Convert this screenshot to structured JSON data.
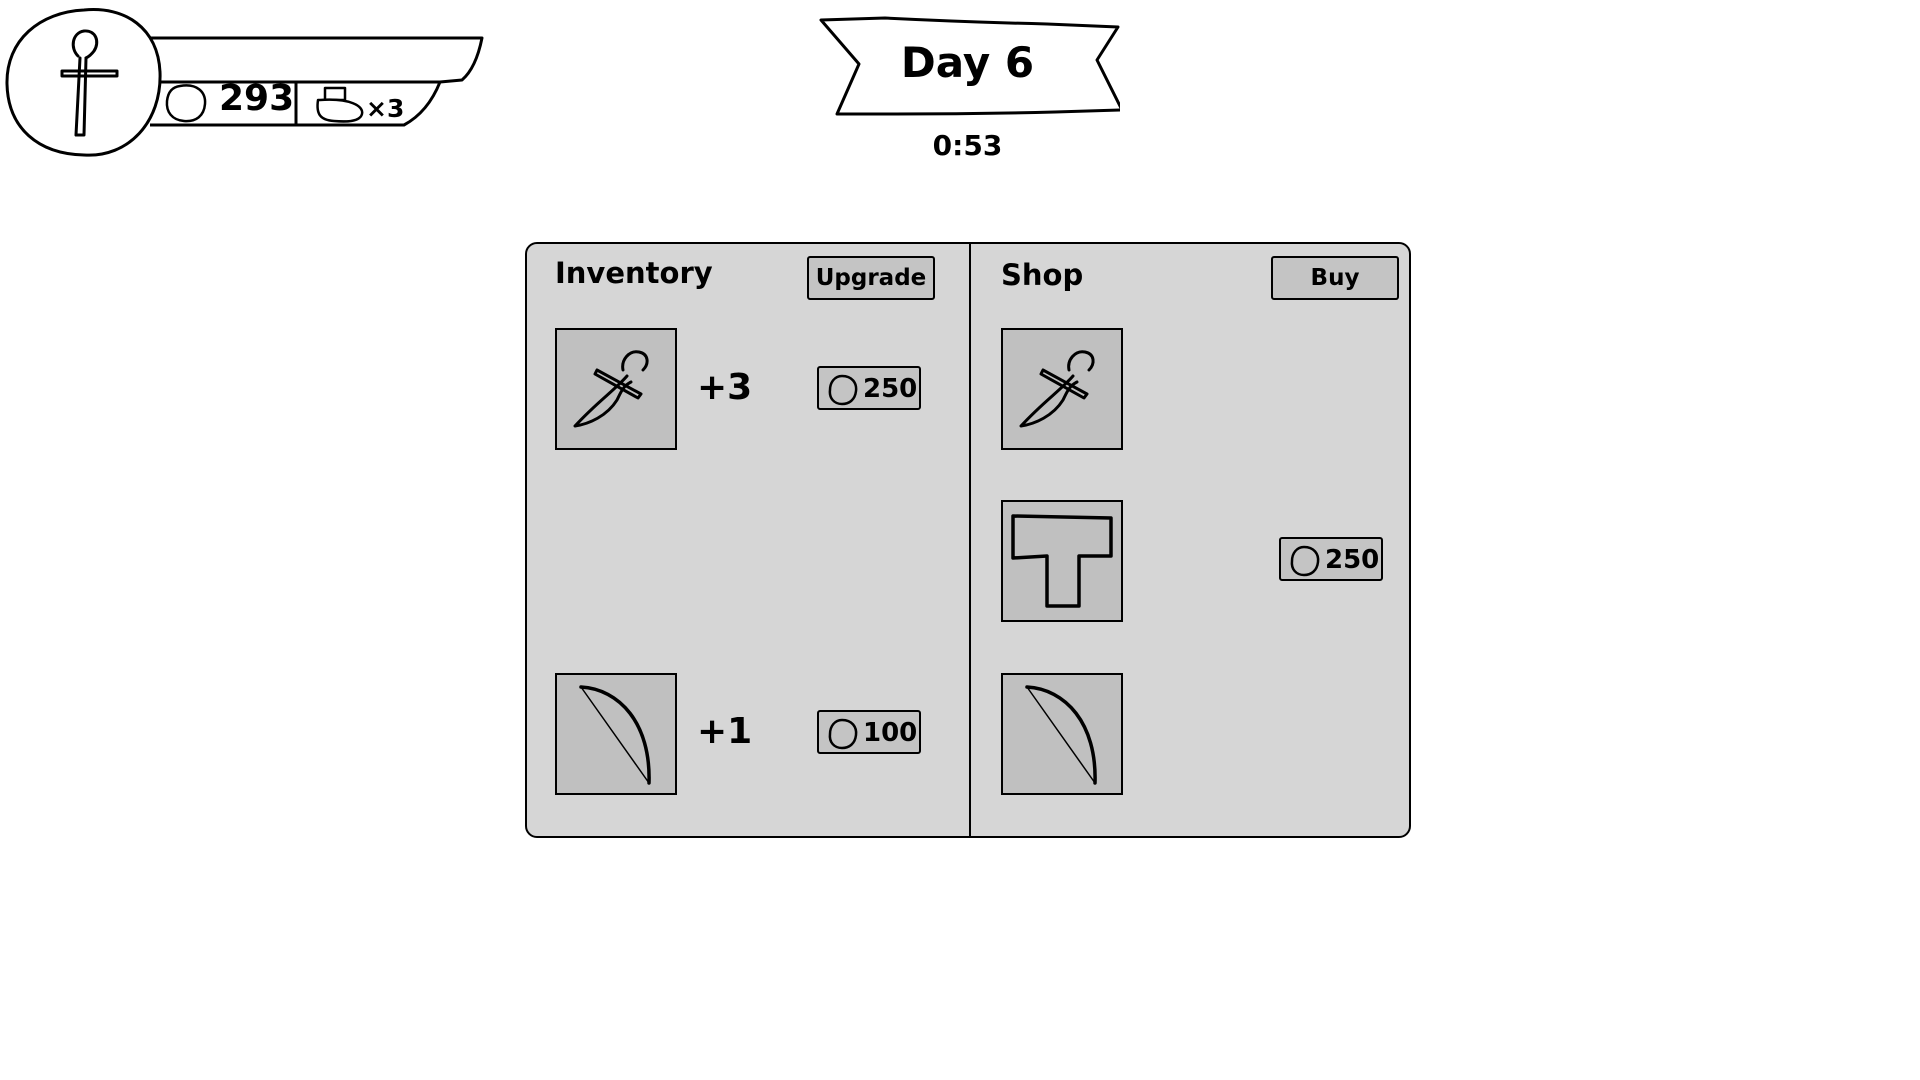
{
  "hud": {
    "gold": "293",
    "potions": "×3",
    "icons": [
      "dagger-icon",
      "coin-icon",
      "potion-icon"
    ]
  },
  "day": {
    "title": "Day 6",
    "timer": "0:53"
  },
  "inventory": {
    "title": "Inventory",
    "upgrade_label": "Upgrade",
    "items": [
      {
        "icon": "dagger-icon",
        "level": "+3",
        "price": "250"
      },
      {
        "icon": "bow-icon",
        "level": "+1",
        "price": "100"
      }
    ]
  },
  "shop": {
    "title": "Shop",
    "buy_label": "Buy",
    "items": [
      {
        "icon": "dagger-icon"
      },
      {
        "icon": "chestplate-icon",
        "price": "250"
      },
      {
        "icon": "bow-icon"
      }
    ]
  },
  "colors": {
    "panel": "#d6d6d6",
    "slot": "#c0c0c0",
    "button": "#c4c4c4",
    "outline": "#000000"
  }
}
